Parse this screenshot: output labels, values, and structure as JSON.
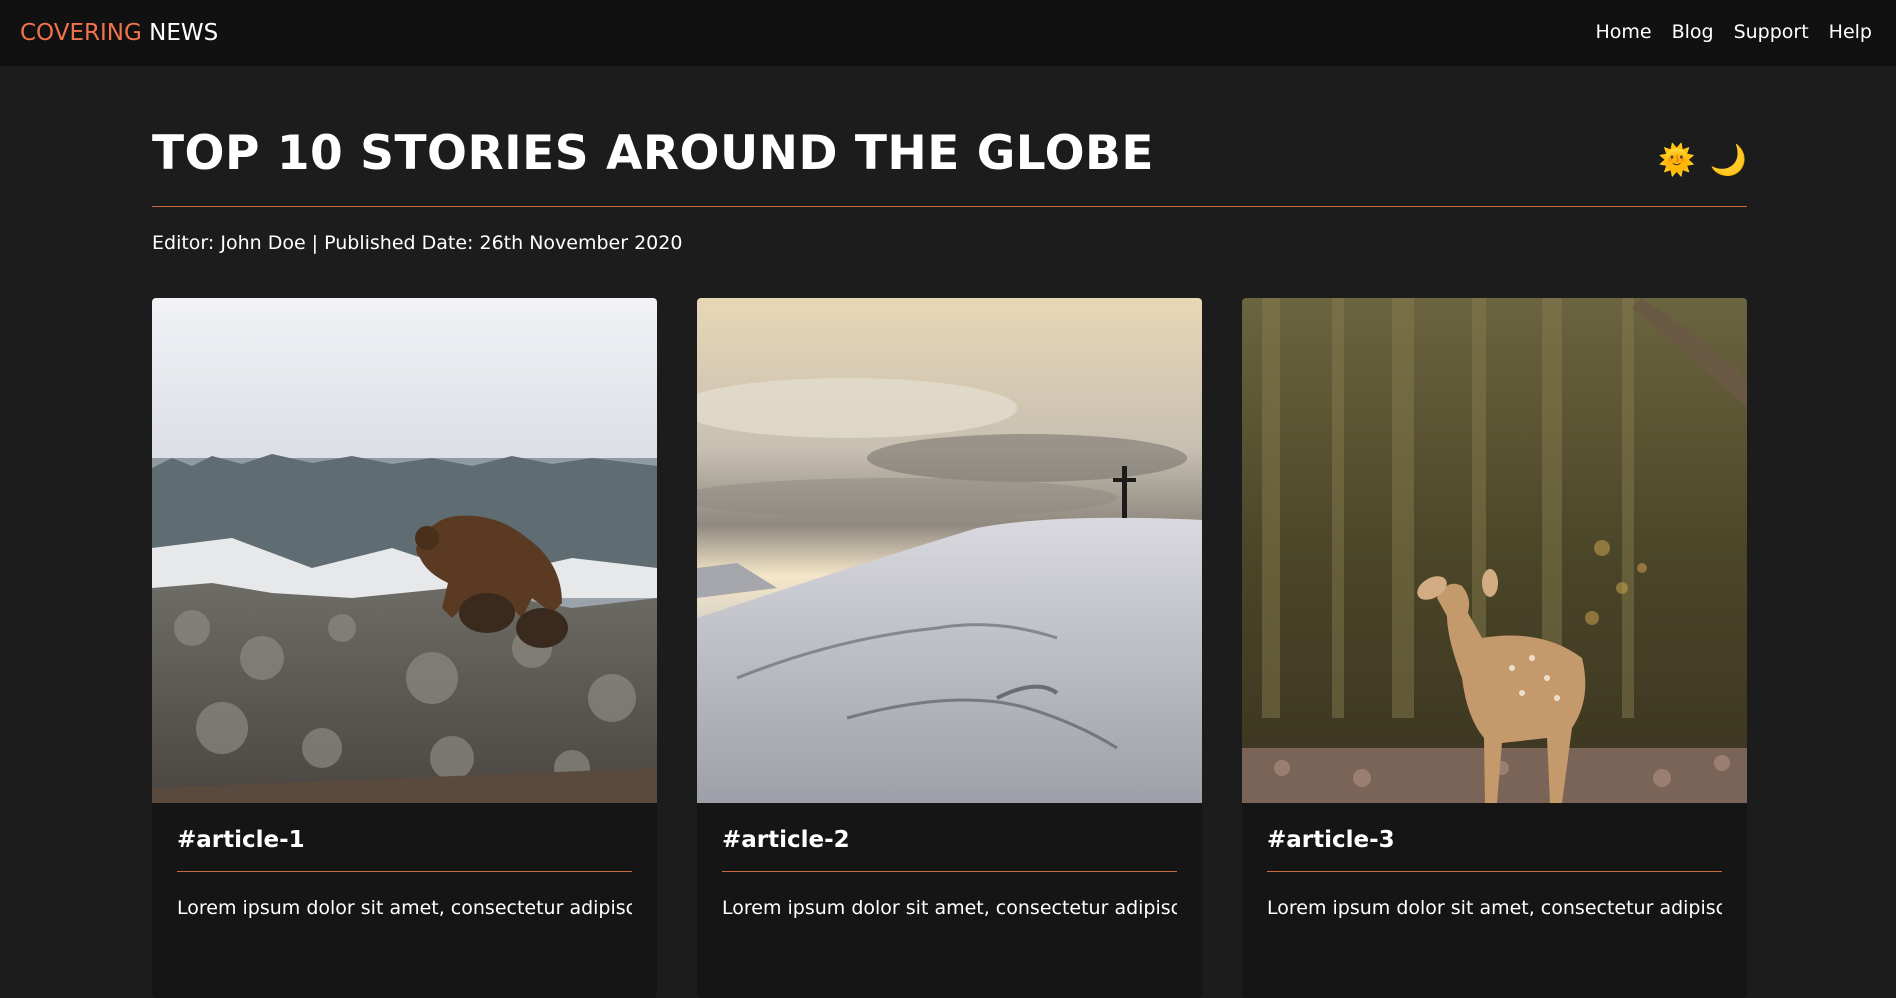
{
  "header": {
    "brand_accent": "COVERING",
    "brand_rest": "NEWS",
    "nav": [
      "Home",
      "Blog",
      "Support",
      "Help"
    ]
  },
  "page": {
    "title": "TOP 10 STORIES AROUND THE GLOBE",
    "meta": "Editor: John Doe | Published Date: 26th November 2020",
    "toggles": {
      "light": "🌞",
      "dark": "🌙"
    }
  },
  "articles": [
    {
      "title": "#article-1",
      "text": "Lorem ipsum dolor sit amet, consectetur adipiscing",
      "image": "bear-with-cubs-photo"
    },
    {
      "title": "#article-2",
      "text": "Lorem ipsum dolor sit amet, consectetur adipiscing",
      "image": "snowy-hill-cross-photo"
    },
    {
      "title": "#article-3",
      "text": "Lorem ipsum dolor sit amet, consectetur adipiscing",
      "image": "fawn-in-forest-photo"
    }
  ],
  "colors": {
    "accent": "#f0734d",
    "rule": "#c86a3c",
    "background": "#1c1c1c",
    "topbar": "#111111"
  }
}
